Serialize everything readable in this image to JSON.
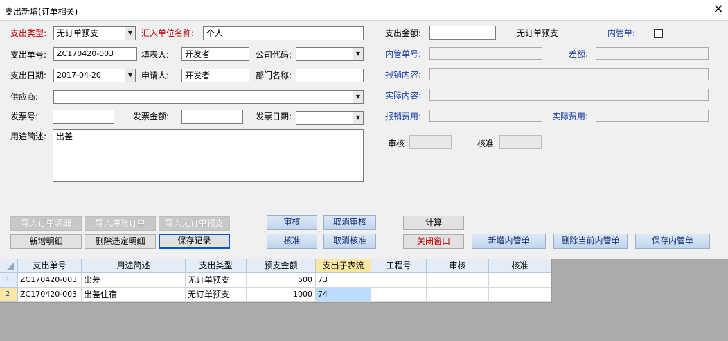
{
  "window": {
    "title": "支出新增(订单相关)"
  },
  "form": {
    "expense_type_label": "支出类型:",
    "expense_type_value": "无订单预支",
    "payee_unit_label": "汇入单位名称:",
    "payee_unit_value": "个人",
    "expense_no_label": "支出单号:",
    "expense_no_value": "ZC170420-003",
    "filler_label": "填表人:",
    "filler_value": "开发者",
    "company_code_label": "公司代码:",
    "company_code_value": "",
    "expense_date_label": "支出日期:",
    "expense_date_value": "2017-04-20",
    "applicant_label": "申请人:",
    "applicant_value": "开发者",
    "dept_label": "部门名称:",
    "dept_value": "",
    "supplier_label": "供应商:",
    "supplier_value": "",
    "invoice_no_label": "发票号:",
    "invoice_no_value": "",
    "invoice_amount_label": "发票金额:",
    "invoice_amount_value": "",
    "invoice_date_label": "发票日期:",
    "invoice_date_value": "",
    "purpose_label": "用途简述:",
    "purpose_value": "出差",
    "amount_label": "支出金额:",
    "amount_value": "",
    "no_order_text": "无订单预支",
    "internal_label": "内管单:",
    "internal_no_label": "内管单号:",
    "internal_no_value": "",
    "diff_label": "差额:",
    "diff_value": "",
    "reimb_content_label": "报销内容:",
    "reimb_content_value": "",
    "actual_content_label": "实际内容:",
    "actual_content_value": "",
    "reimb_fee_label": "报销费用:",
    "reimb_fee_value": "",
    "actual_fee_label": "实际费用:",
    "actual_fee_value": "",
    "audit_label": "审核",
    "audit_value": "",
    "approve_label": "核准",
    "approve_value": ""
  },
  "buttons": {
    "import_order": "导入订单明细",
    "import_offset": "导入冲账订单",
    "import_no_order": "导入无订单预支",
    "add_detail": "新增明细",
    "delete_detail": "删除选定明细",
    "save": "保存记录",
    "audit": "审核",
    "cancel_audit": "取消审核",
    "approve": "核准",
    "cancel_approve": "取消核准",
    "calc": "计算",
    "close": "关闭窗口",
    "add_internal": "新增内管单",
    "delete_internal": "删除当前内管单",
    "save_internal": "保存内管单"
  },
  "grid": {
    "headers": [
      "支出单号",
      "用途简述",
      "支出类型",
      "预支金额",
      "支出子表流",
      "工程号",
      "审核",
      "核准"
    ],
    "rows": [
      {
        "num": "1",
        "cells": [
          "ZC170420-003",
          "出差",
          "无订单预支",
          "500",
          "73",
          "",
          "",
          ""
        ]
      },
      {
        "num": "2",
        "cells": [
          "ZC170420-003",
          "出差住宿",
          "无订单预支",
          "1000",
          "74",
          "",
          "",
          ""
        ]
      }
    ]
  },
  "colors": {
    "required_label": "#c00000",
    "blue_label": "#1a3ea8",
    "selected_header": "#fbe7a4",
    "selected_cell": "#bcdcff"
  }
}
